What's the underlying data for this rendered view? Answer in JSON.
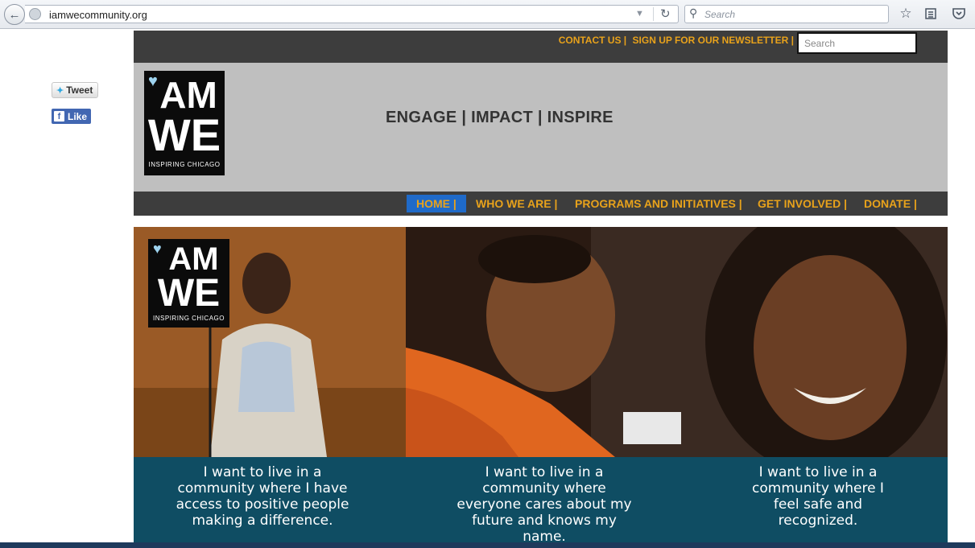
{
  "browser": {
    "url": "iamwecommunity.org",
    "search_placeholder": "Search"
  },
  "social": {
    "tweet_label": "Tweet",
    "like_label": "Like"
  },
  "header": {
    "top_links": [
      "CONTACT US |",
      "SIGN UP FOR OUR NEWSLETTER |"
    ],
    "search_placeholder": "Search",
    "tagline": "ENGAGE | IMPACT | INSPIRE"
  },
  "logo": {
    "line1": "AM",
    "line2": "WE",
    "tagline": "INSPIRING CHICAGO"
  },
  "nav": {
    "items": [
      "HOME |",
      "WHO WE ARE |",
      "PROGRAMS AND INITIATIVES |",
      "GET INVOLVED |",
      "DONATE |"
    ],
    "active": "HOME |"
  },
  "hero": {
    "captions": [
      "I want to live in a community where I have access to positive people making a difference.",
      "I want to live in a community where everyone cares about my future and knows my name.",
      "I want to live in a community where I feel safe and recognized."
    ]
  },
  "colors": {
    "accent": "#e8a21b",
    "bar": "#3d3d3d",
    "banner": "#bfbfbf",
    "active_nav": "#1f6ac9",
    "hero_band": "#0f4d63"
  }
}
